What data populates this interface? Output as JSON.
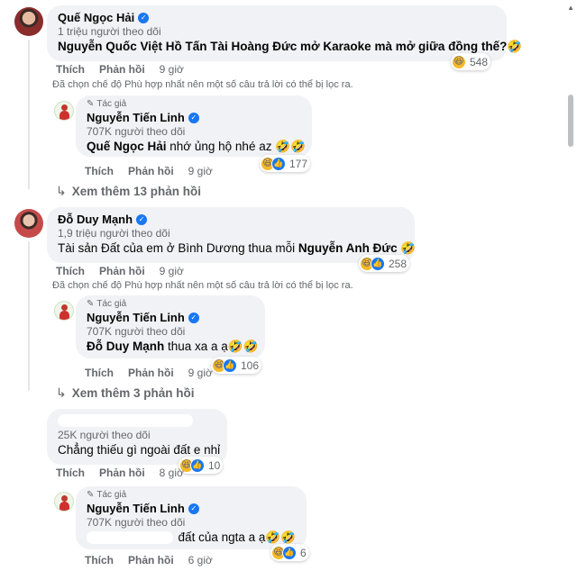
{
  "c1": {
    "name": "Quế Ngọc Hải",
    "followers": "1 triệu người theo dõi",
    "text": "Nguyễn Quốc Việt Hồ Tấn Tài Hoàng Đức mở Karaoke mà mở giữa đồng thế?🤣",
    "like": "Thích",
    "reply": "Phản hồi",
    "time": "9 giờ",
    "reactions": "548",
    "notice": "Đã chọn chế độ Phù hợp nhất nên một số câu trả lời có thể bị lọc ra.",
    "r1": {
      "tag": "Tác giả",
      "name": "Nguyễn Tiến Linh",
      "followers": "707K người theo dõi",
      "mention": "Quế Ngọc Hải",
      "text": " nhớ ủng hộ nhé az 🤣🤣",
      "like": "Thích",
      "reply": "Phản hồi",
      "time": "9 giờ",
      "reactions": "177"
    },
    "more": "Xem thêm 13 phản hồi"
  },
  "c2": {
    "name": "Đỗ Duy Mạnh",
    "followers": "1,9 triệu người theo dõi",
    "text": "Tài sản Đất của em ở Bình Dương thua mỗi ",
    "mention": "Nguyễn Anh Đức",
    "text_end": " 🤣",
    "like": "Thích",
    "reply": "Phản hồi",
    "time": "9 giờ",
    "reactions": "258",
    "notice": "Đã chọn chế độ Phù hợp nhất nên một số câu trả lời có thể bị lọc ra.",
    "r1": {
      "tag": "Tác giả",
      "name": "Nguyễn Tiến Linh",
      "followers": "707K người theo dõi",
      "mention": "Đỗ Duy Mạnh",
      "text": " thua xa a ạ🤣🤣",
      "like": "Thích",
      "reply": "Phản hồi",
      "time": "9 giờ",
      "reactions": "106"
    },
    "more": "Xem thêm 3 phản hồi"
  },
  "c3": {
    "followers": "25K người theo dõi",
    "text": "Chẳng thiếu gì ngoài đất e nhỉ",
    "like": "Thích",
    "reply": "Phản hồi",
    "time": "8 giờ",
    "reactions": "10",
    "r1": {
      "tag": "Tác giả",
      "name": "Nguyễn Tiến Linh",
      "followers": "707K người theo dõi",
      "text": "đất của ngta a ạ🤣🤣",
      "like": "Thích",
      "reply": "Phản hồi",
      "time": "6 giờ",
      "reactions": "6"
    }
  },
  "icons": {
    "verified": "✓",
    "haha": "😆",
    "like": "👍",
    "pencil": "✎",
    "arrow": "↳",
    "scroll_up": "▲"
  },
  "colors": {
    "bubble": "#f0f2f5",
    "secondary_text": "#65676b",
    "verified_blue": "#1877f2",
    "haha_yellow": "#f7b928"
  }
}
